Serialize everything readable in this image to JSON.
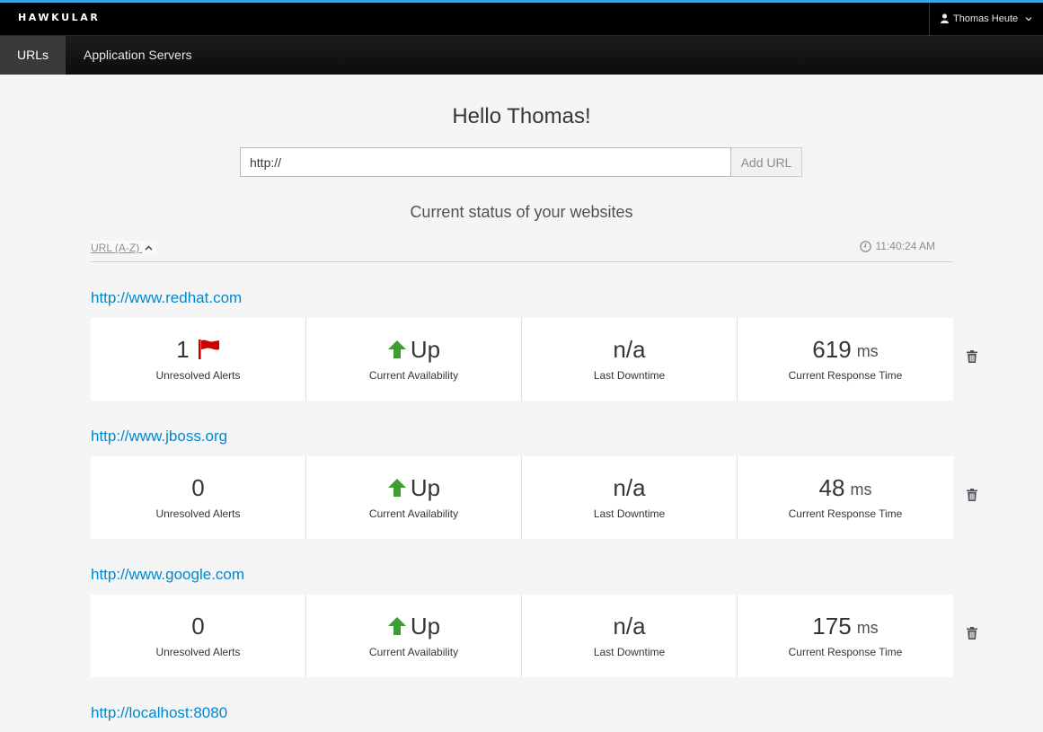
{
  "app": {
    "brand": "HAWKULAR"
  },
  "user": {
    "name": "Thomas Heute"
  },
  "nav": {
    "tabs": [
      {
        "label": "URLs",
        "active": true
      },
      {
        "label": "Application Servers",
        "active": false
      }
    ]
  },
  "greeting": "Hello Thomas!",
  "url_form": {
    "value": "http://",
    "button": "Add URL"
  },
  "status_heading": "Current status of your websites",
  "sort": {
    "label": "URL (A-Z)",
    "direction": "ascending"
  },
  "timestamp": "11:40:24 AM",
  "labels": {
    "alerts": "Unresolved Alerts",
    "availability": "Current Availability",
    "downtime": "Last Downtime",
    "response": "Current Response Time"
  },
  "sites": [
    {
      "url": "http://www.redhat.com",
      "alerts": "1",
      "has_alert_flag": true,
      "availability": "Up",
      "downtime": "n/a",
      "response": "619",
      "unit": "ms"
    },
    {
      "url": "http://www.jboss.org",
      "alerts": "0",
      "has_alert_flag": false,
      "availability": "Up",
      "downtime": "n/a",
      "response": "48",
      "unit": "ms"
    },
    {
      "url": "http://www.google.com",
      "alerts": "0",
      "has_alert_flag": false,
      "availability": "Up",
      "downtime": "n/a",
      "response": "175",
      "unit": "ms"
    },
    {
      "url": "http://localhost:8080"
    }
  ],
  "colors": {
    "accent": "#39a5dc",
    "link": "#0088ce",
    "up": "#3f9c35",
    "alert": "#cc0000"
  },
  "icons": {
    "user": "user-icon",
    "clock": "clock-icon",
    "up": "arrow-up-icon",
    "flag": "flag-icon",
    "delete": "trash-icon"
  }
}
